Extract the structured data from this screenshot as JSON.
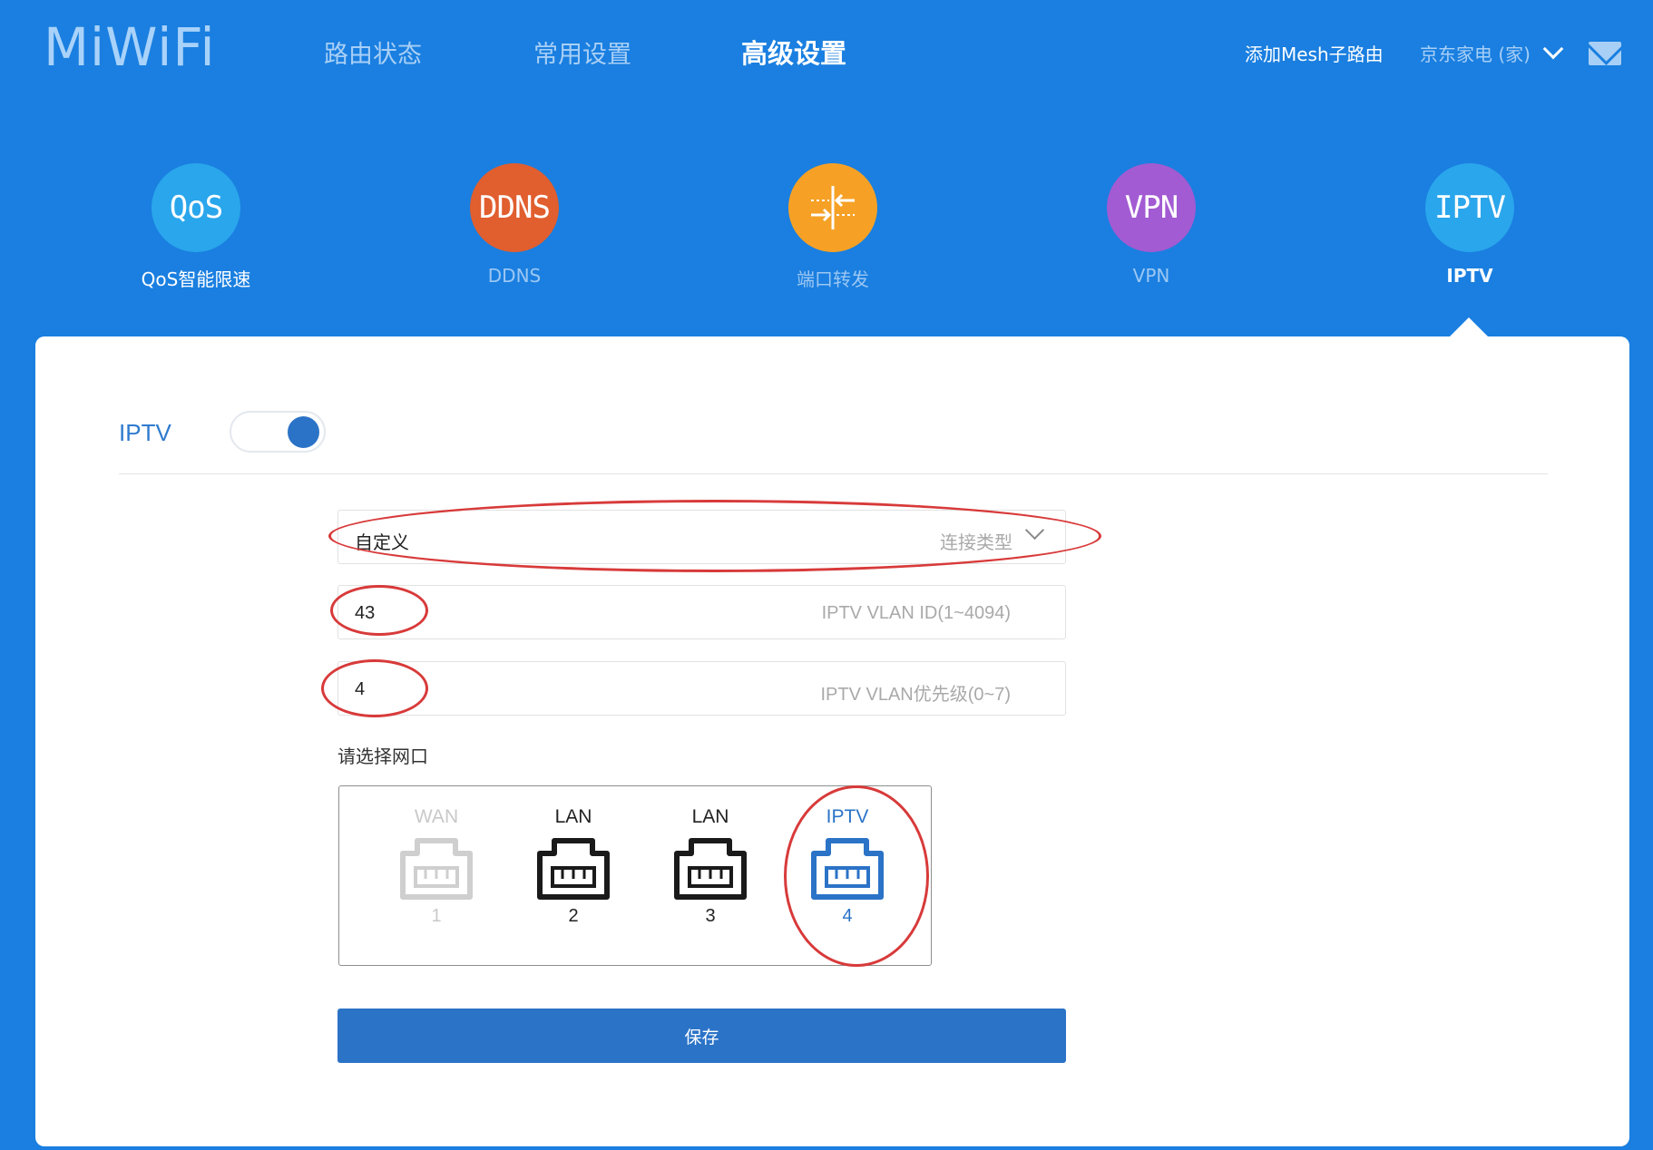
{
  "header": {
    "logo": "MiWiFi",
    "nav": [
      {
        "label": "路由状态"
      },
      {
        "label": "常用设置"
      },
      {
        "label": "高级设置"
      }
    ],
    "add_mesh": "添加Mesh子路由",
    "user": "京东家电 (家)"
  },
  "features": [
    {
      "icon_text": "QoS",
      "label": "QoS智能限速",
      "color": "#2aa6ec"
    },
    {
      "icon_text": "DDNS",
      "label": "DDNS",
      "color": "#e15e2e"
    },
    {
      "icon_text": "",
      "label": "端口转发",
      "color": "#f6a125"
    },
    {
      "icon_text": "VPN",
      "label": "VPN",
      "color": "#a25bd2"
    },
    {
      "icon_text": "IPTV",
      "label": "IPTV",
      "color": "#2aa6ec"
    }
  ],
  "panel": {
    "title": "IPTV",
    "toggle_on": true,
    "connection": {
      "value": "自定义",
      "placeholder": "连接类型"
    },
    "vlan_id": {
      "value": "43",
      "placeholder": "IPTV VLAN ID(1~4094)"
    },
    "vlan_priority": {
      "value": "4",
      "placeholder": "IPTV VLAN优先级(0~7)"
    },
    "port_select_label": "请选择网口",
    "ports": [
      {
        "type": "WAN",
        "number": "1",
        "state": "disabled"
      },
      {
        "type": "LAN",
        "number": "2",
        "state": "normal"
      },
      {
        "type": "LAN",
        "number": "3",
        "state": "normal"
      },
      {
        "type": "IPTV",
        "number": "4",
        "state": "selected"
      }
    ],
    "save_label": "保存"
  }
}
